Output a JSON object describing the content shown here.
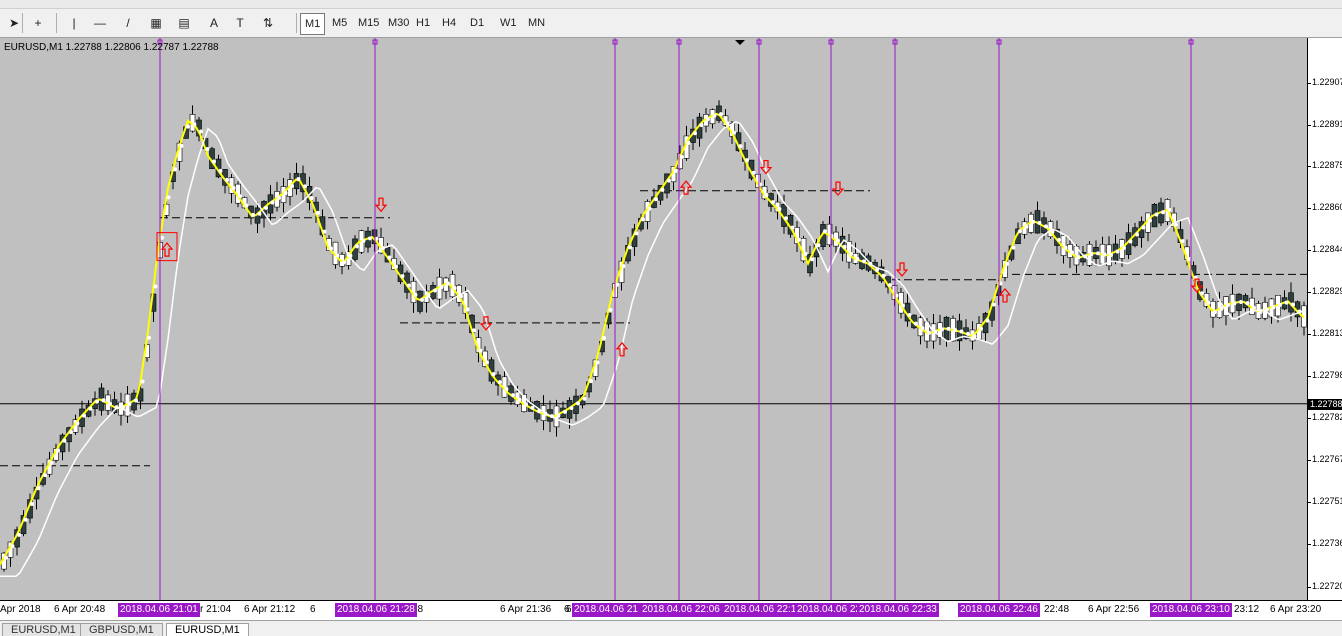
{
  "toolbar": {
    "timeframes": [
      "M1",
      "M5",
      "M15",
      "M30",
      "H1",
      "H4",
      "D1",
      "W1",
      "MN"
    ],
    "active_timeframe": "M1",
    "tools": [
      {
        "name": "cursor-icon",
        "glyph": "➤"
      },
      {
        "name": "crosshair-icon",
        "glyph": "+"
      },
      {
        "name": "vertical-line-icon",
        "glyph": "|"
      },
      {
        "name": "horizontal-line-icon",
        "glyph": "—"
      },
      {
        "name": "trendline-icon",
        "glyph": "/"
      },
      {
        "name": "fibonacci-icon",
        "glyph": "▦"
      },
      {
        "name": "fib-grid-icon",
        "glyph": "▤"
      },
      {
        "name": "text-icon",
        "glyph": "A"
      },
      {
        "name": "label-icon",
        "glyph": "T"
      },
      {
        "name": "arrows-icon",
        "glyph": "⇅"
      }
    ]
  },
  "chart": {
    "symbol_info": "EURUSD,M1  1.22788 1.22806 1.22787 1.22788",
    "current_price": "1.22788",
    "price_labels": [
      "1.22907",
      "1.22891",
      "1.22875",
      "1.22860",
      "1.22844",
      "1.22829",
      "1.22813",
      "1.22798",
      "1.22782",
      "1.22767",
      "1.22751",
      "1.22736",
      "1.22720"
    ],
    "time_labels": [
      "Apr 2018",
      "6 Apr 20:48",
      "6 Apr 21:04",
      "6 Apr 21:12",
      "6",
      "28",
      "6 Apr 21:36",
      "6 Apr 21:44",
      "6",
      "22:48",
      "6 Apr 22:56",
      "23:12",
      "6 Apr 23:20"
    ],
    "vline_labels": [
      "2018.04.06 21:01",
      "2018.04.06 21:28",
      "2018.04.06 21",
      "2018.04.06 22:06",
      "2018.04.06 22:16",
      "2018.04.06 22",
      "2018.04.06 22:33",
      "2018.04.06 22:46",
      "2018.04.06 23:10"
    ],
    "colors": {
      "background": "#c0c0c0",
      "fast_ma": "#ffff00",
      "slow_ma": "#ffffff",
      "vlines": "#9a18c8",
      "arrows": "#ff0000",
      "bull_candle": "#ffffff",
      "bear_candle": "#2f3f3f"
    }
  },
  "tabs": [
    {
      "label": "EURUSD,M1",
      "active": false
    },
    {
      "label": "GBPUSD,M1",
      "active": false
    },
    {
      "label": "EURUSD,M1",
      "active": true
    }
  ]
}
